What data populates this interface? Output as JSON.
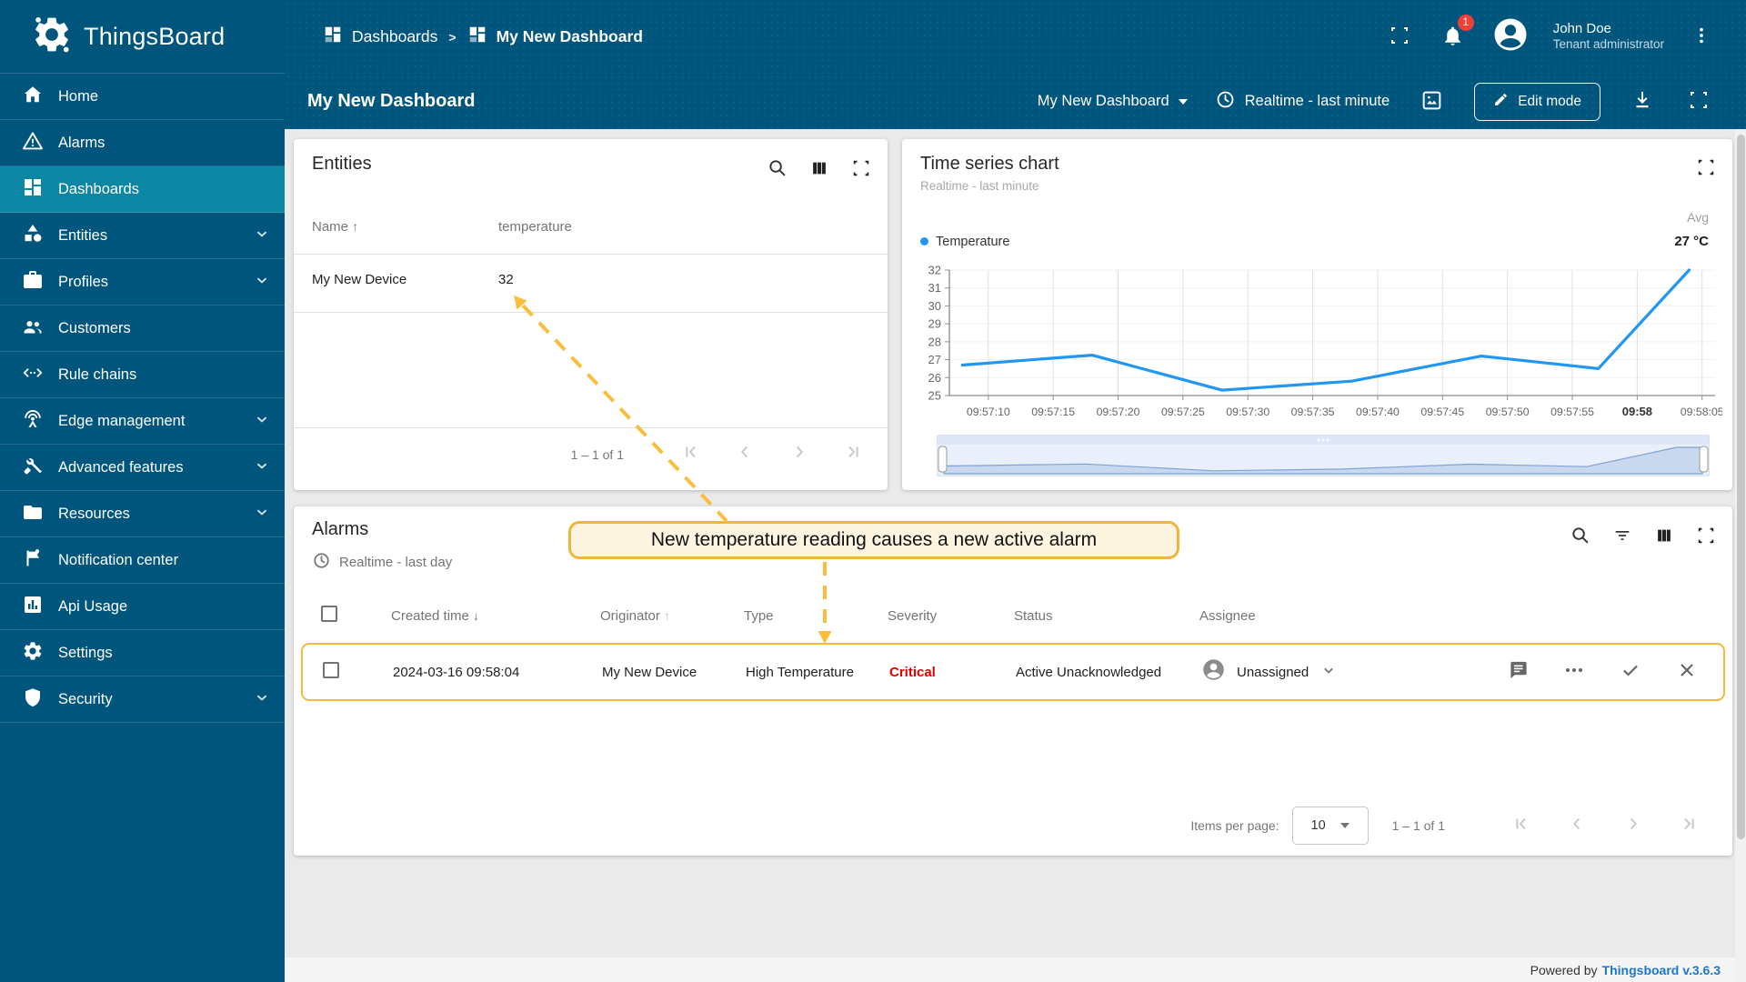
{
  "colors": {
    "primary": "#00557d",
    "primary_selected": "#0b86a4",
    "critical": "#e00000",
    "chart_line": "#2196f3",
    "annotation_border": "#f2b53b",
    "annotation_bg": "#fdf5e0",
    "arrow": "#fbbe3c",
    "link": "#1a76d2",
    "notification_badge": "#ef4036"
  },
  "brand": {
    "name": "ThingsBoard"
  },
  "topbar": {
    "breadcrumb": {
      "root": "Dashboards",
      "separator": ">",
      "current": "My New Dashboard"
    },
    "notifications_badge": "1",
    "user": {
      "name": "John Doe",
      "role": "Tenant administrator"
    }
  },
  "toolbar": {
    "page_title": "My New Dashboard",
    "dashboard_select": "My New Dashboard",
    "timewindow": "Realtime - last minute",
    "edit_button": "Edit mode"
  },
  "sidebar": {
    "items": [
      {
        "label": "Home",
        "icon": "home",
        "selected": false,
        "expandable": false
      },
      {
        "label": "Alarms",
        "icon": "alarm-warning",
        "selected": false,
        "expandable": false
      },
      {
        "label": "Dashboards",
        "icon": "dashboards",
        "selected": true,
        "expandable": false
      },
      {
        "label": "Entities",
        "icon": "entities",
        "selected": false,
        "expandable": true
      },
      {
        "label": "Profiles",
        "icon": "profiles",
        "selected": false,
        "expandable": true
      },
      {
        "label": "Customers",
        "icon": "customers",
        "selected": false,
        "expandable": false
      },
      {
        "label": "Rule chains",
        "icon": "rule-chains",
        "selected": false,
        "expandable": false
      },
      {
        "label": "Edge management",
        "icon": "edge-antenna",
        "selected": false,
        "expandable": true
      },
      {
        "label": "Advanced features",
        "icon": "advanced-tools",
        "selected": false,
        "expandable": true
      },
      {
        "label": "Resources",
        "icon": "folder",
        "selected": false,
        "expandable": true
      },
      {
        "label": "Notification center",
        "icon": "notification-flag",
        "selected": false,
        "expandable": false
      },
      {
        "label": "Api Usage",
        "icon": "api-chart",
        "selected": false,
        "expandable": false
      },
      {
        "label": "Settings",
        "icon": "settings-gear",
        "selected": false,
        "expandable": false
      },
      {
        "label": "Security",
        "icon": "security-shield",
        "selected": false,
        "expandable": true
      }
    ]
  },
  "entities_widget": {
    "title": "Entities",
    "columns": {
      "name": "Name",
      "name_sort": "↑",
      "temperature": "temperature"
    },
    "row": {
      "name": "My New Device",
      "temperature": "32"
    },
    "pagination": "1 – 1 of 1"
  },
  "chart_widget": {
    "title": "Time series chart",
    "subtitle": "Realtime - last minute",
    "agg_header": "Avg",
    "legend_series": "Temperature",
    "legend_value": "27 °C"
  },
  "chart_data": {
    "type": "line",
    "title": "Time series chart",
    "xlabel": "",
    "ylabel": "",
    "x": [
      "09:57:08",
      "09:57:18",
      "09:57:28",
      "09:57:38",
      "09:57:48",
      "09:57:57",
      "09:58:04"
    ],
    "series": [
      {
        "name": "Temperature",
        "values": [
          26.7,
          27.25,
          25.3,
          25.8,
          27.2,
          26.5,
          32
        ]
      }
    ],
    "ylim": [
      25,
      32
    ],
    "yticks": [
      32,
      31,
      30,
      29,
      28,
      27,
      26,
      25
    ],
    "xticks": [
      "09:57:10",
      "09:57:15",
      "09:57:20",
      "09:57:25",
      "09:57:30",
      "09:57:35",
      "09:57:40",
      "09:57:45",
      "09:57:50",
      "09:57:55",
      "09:58",
      "09:58:05"
    ],
    "xdomain": [
      "09:57:07",
      "09:58:06"
    ],
    "bold_xtick": "09:58",
    "grid": true,
    "legend_position": "top",
    "avg_value": "27 °C"
  },
  "annotation": {
    "text": "New temperature reading causes a new active alarm"
  },
  "alarms_widget": {
    "title": "Alarms",
    "subtitle": "Realtime - last day",
    "columns": {
      "created": "Created time",
      "created_sort": "↓",
      "originator": "Originator",
      "originator_sort": "↑",
      "type": "Type",
      "severity": "Severity",
      "status": "Status",
      "assignee": "Assignee"
    },
    "row": {
      "created_time": "2024-03-16 09:58:04",
      "originator": "My New Device",
      "type": "High Temperature",
      "severity": "Critical",
      "status": "Active Unacknowledged",
      "assignee": "Unassigned"
    },
    "items_per_page_label": "Items per page:",
    "items_per_page": "10",
    "pagination": "1 – 1 of 1"
  },
  "footer": {
    "powered_by": "Powered by",
    "version_link": "Thingsboard v.3.6.3"
  }
}
